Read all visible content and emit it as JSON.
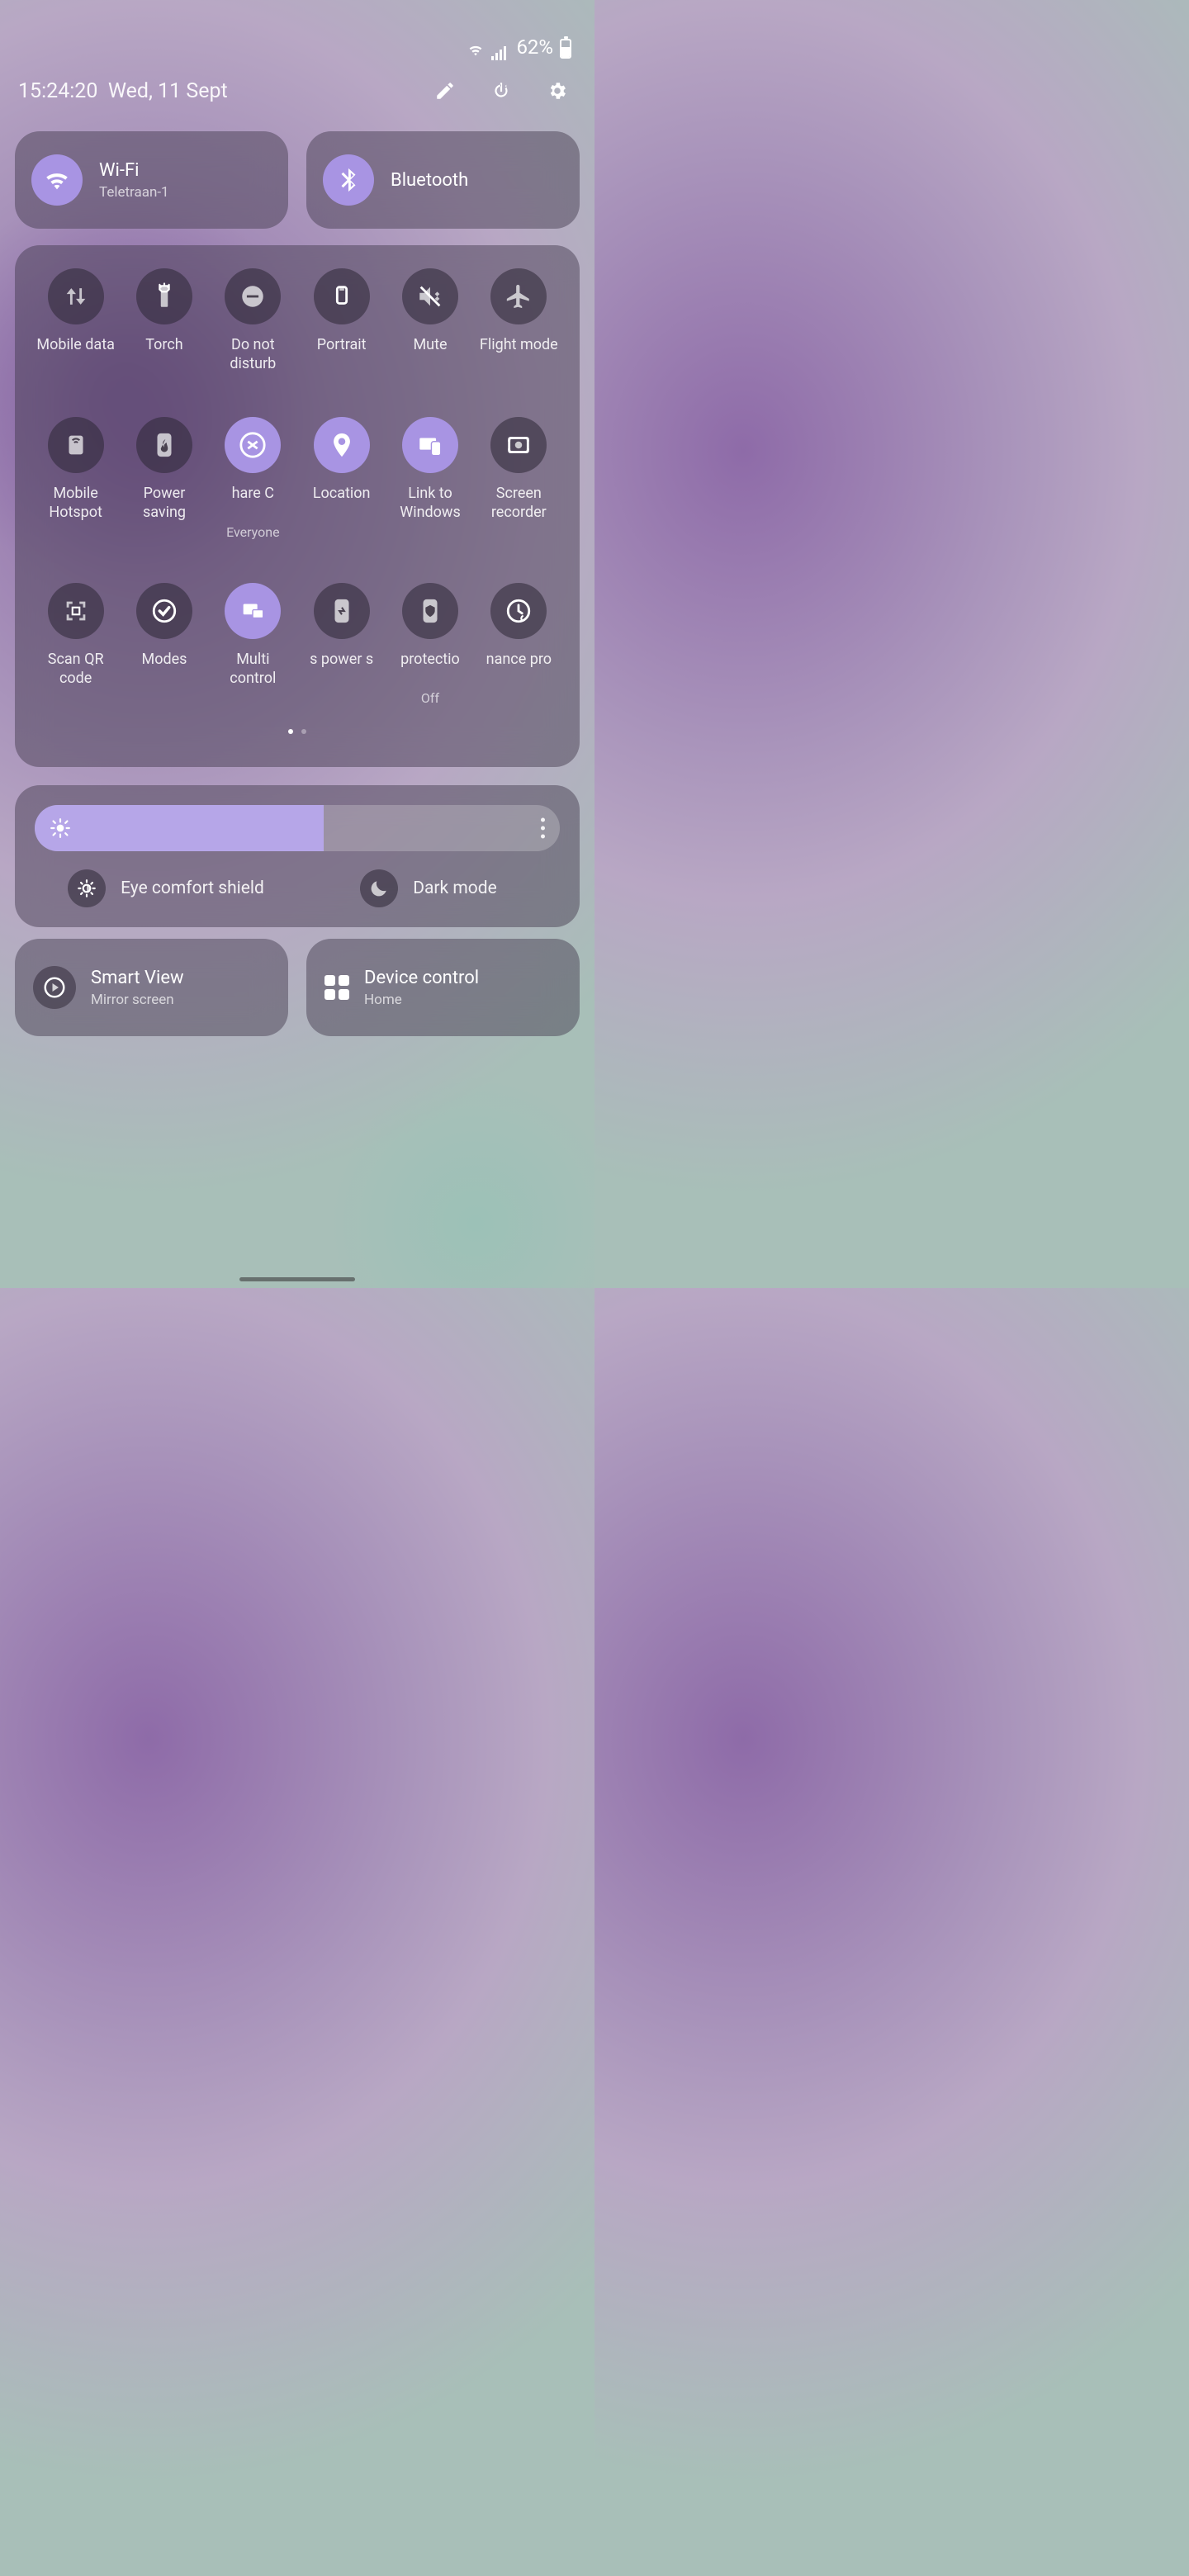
{
  "status": {
    "battery_pct": "62%",
    "battery_fill": 62
  },
  "header": {
    "time": "15:24:20",
    "date": "Wed, 11 Sept"
  },
  "pills": {
    "wifi": {
      "title": "Wi-Fi",
      "sub": "Teletraan-1"
    },
    "bt": {
      "title": "Bluetooth"
    }
  },
  "tiles": [
    {
      "id": "mobile-data",
      "label": "Mobile data",
      "on": false
    },
    {
      "id": "torch",
      "label": "Torch",
      "on": false
    },
    {
      "id": "dnd",
      "label": "Do not disturb",
      "on": false
    },
    {
      "id": "portrait",
      "label": "Portrait",
      "on": false
    },
    {
      "id": "mute",
      "label": "Mute",
      "on": false
    },
    {
      "id": "flight",
      "label": "Flight mode",
      "on": false
    },
    {
      "id": "hotspot",
      "label": "Mobile Hotspot",
      "on": false
    },
    {
      "id": "power-saving",
      "label": "Power saving",
      "on": false
    },
    {
      "id": "quick-share",
      "label": "hare     C",
      "sub": "Everyone",
      "on": true
    },
    {
      "id": "location",
      "label": "Location",
      "on": true
    },
    {
      "id": "link-windows",
      "label": "Link to Windows",
      "on": true
    },
    {
      "id": "screen-rec",
      "label": "Screen recorder",
      "on": false
    },
    {
      "id": "scan-qr",
      "label": "Scan QR code",
      "on": false
    },
    {
      "id": "modes",
      "label": "Modes",
      "on": false
    },
    {
      "id": "multi-control",
      "label": "Multi control",
      "on": true
    },
    {
      "id": "power-share",
      "label": "s power s",
      "on": false
    },
    {
      "id": "protection",
      "label": "protectio",
      "sub": "Off",
      "on": false
    },
    {
      "id": "performance",
      "label": "nance pro",
      "on": false
    }
  ],
  "brightness": {
    "pct": 55,
    "eye": "Eye comfort shield",
    "dark": "Dark mode"
  },
  "bottom": {
    "smartview": {
      "title": "Smart View",
      "sub": "Mirror screen"
    },
    "device": {
      "title": "Device control",
      "sub": "Home"
    }
  }
}
